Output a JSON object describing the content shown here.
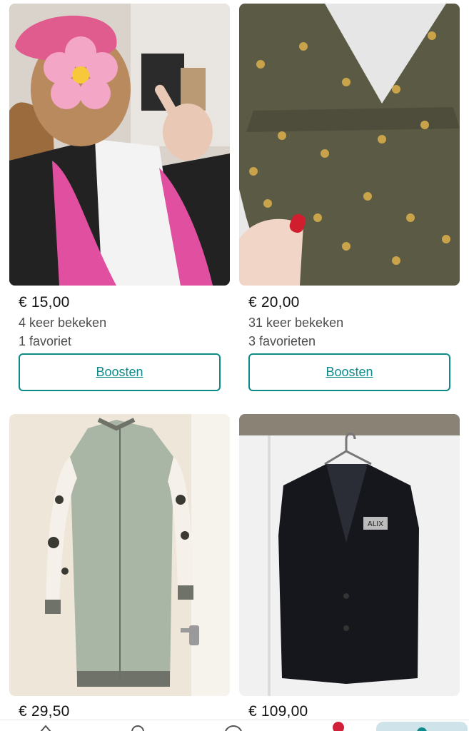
{
  "items": [
    {
      "price": "€ 15,00",
      "views": "4 keer bekeken",
      "favorites": "1 favoriet",
      "action": "Boosten"
    },
    {
      "price": "€ 20,00",
      "views": "31 keer bekeken",
      "favorites": "3 favorieten",
      "action": "Boosten"
    },
    {
      "price": "€ 29,50"
    },
    {
      "price": "€ 109,00",
      "label_text": "ALIX"
    }
  ],
  "colors": {
    "accent": "#0f8a8a",
    "notification_dot": "#d0203a",
    "active_tab_bg": "#cfe3ea"
  },
  "bottom_nav": {
    "icons": [
      "home-icon",
      "search-icon",
      "add-icon",
      "inbox-icon",
      "profile-icon"
    ],
    "active_index": 4
  }
}
